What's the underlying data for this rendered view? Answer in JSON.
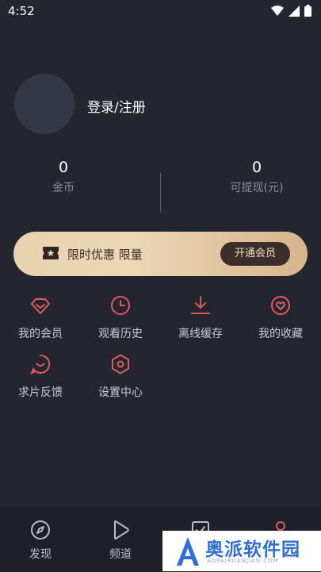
{
  "status": {
    "time": "4:52"
  },
  "profile": {
    "login_text": "登录/注册"
  },
  "stats": {
    "coins": {
      "value": "0",
      "label": "金币"
    },
    "cash": {
      "value": "0",
      "label": "可提现(元)"
    }
  },
  "vip": {
    "text": "限时优惠 限量",
    "button": "开通会员"
  },
  "menu": [
    {
      "label": "我的会员",
      "icon": "diamond-icon"
    },
    {
      "label": "观看历史",
      "icon": "clock-icon"
    },
    {
      "label": "离线缓存",
      "icon": "download-icon"
    },
    {
      "label": "我的收藏",
      "icon": "heart-icon"
    },
    {
      "label": "求片反馈",
      "icon": "feedback-icon"
    },
    {
      "label": "设置中心",
      "icon": "settings-icon"
    }
  ],
  "tabbar": [
    {
      "label": "发现",
      "icon": "compass-icon"
    },
    {
      "label": "频道",
      "icon": "play-icon"
    },
    {
      "label": "",
      "icon": "check-box-icon"
    },
    {
      "label": "",
      "icon": "user-icon"
    }
  ],
  "watermark": {
    "title": "奥派软件园",
    "subtitle": "AOPAIRUANJIAN.COM"
  },
  "colors": {
    "accent": "#e5575e",
    "background": "#24262f",
    "vip_gold": "#e9d2b0"
  }
}
